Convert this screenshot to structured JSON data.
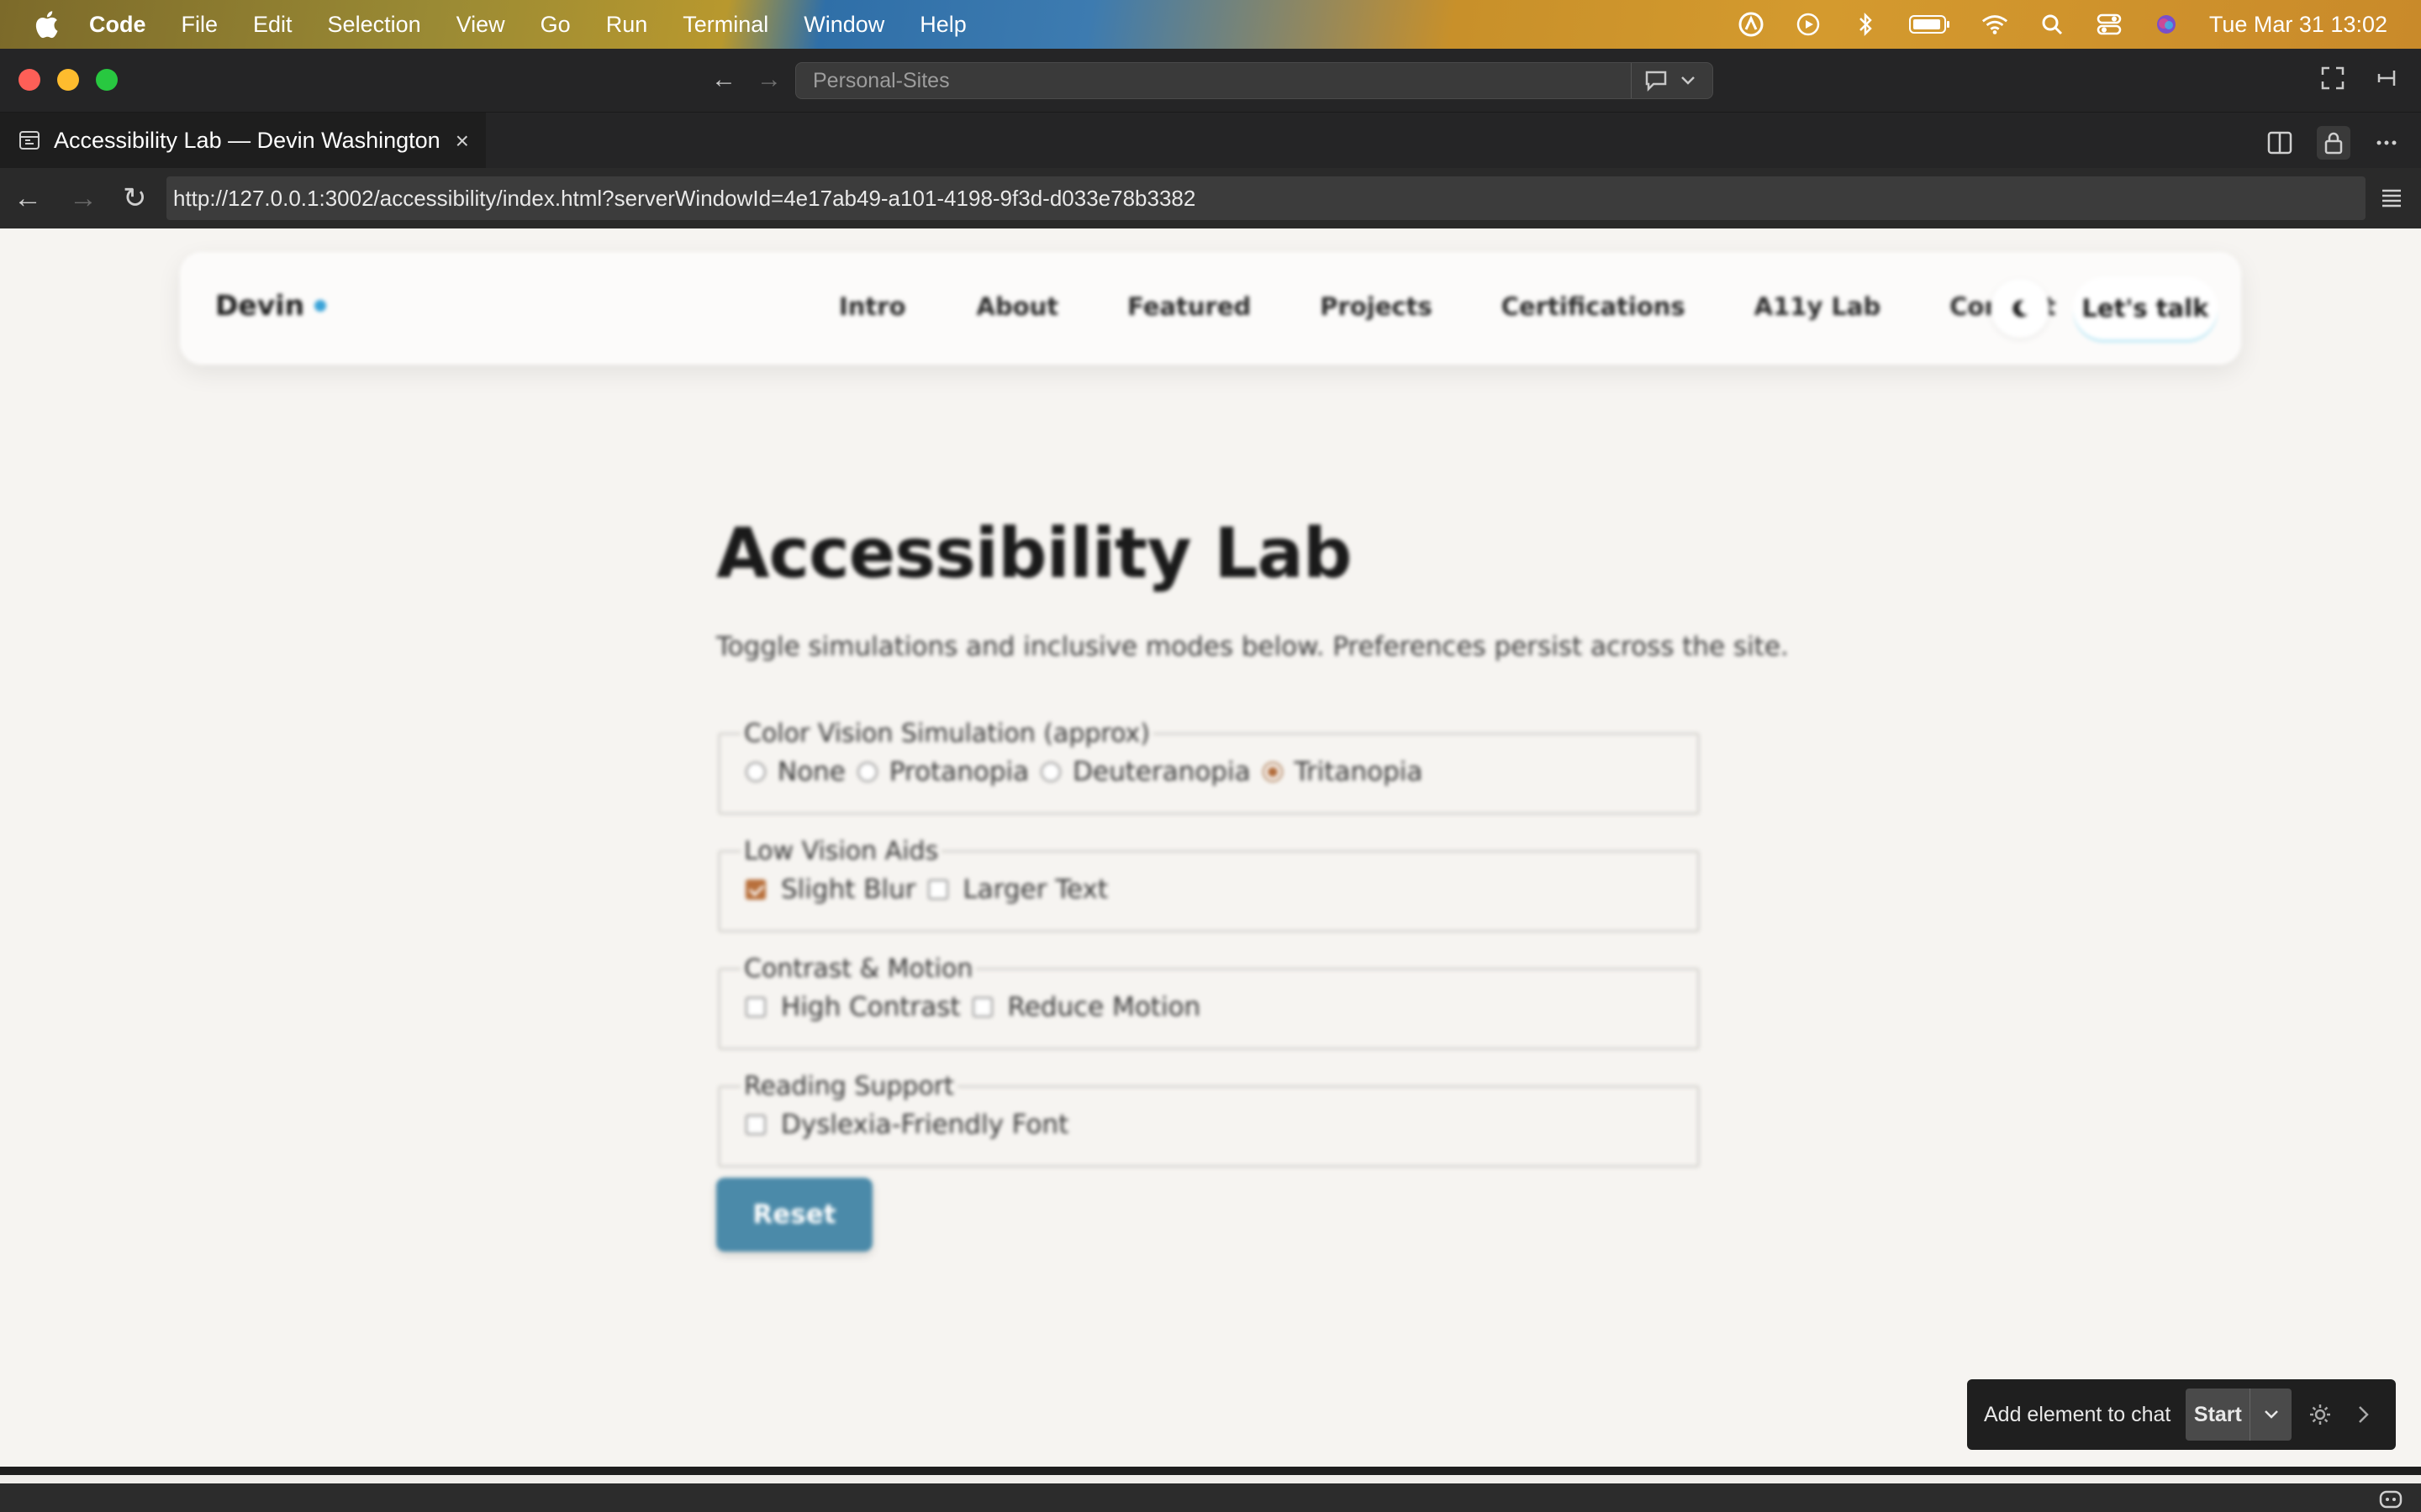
{
  "menubar": {
    "app_name": "Code",
    "items": [
      "File",
      "Edit",
      "Selection",
      "View",
      "Go",
      "Run",
      "Terminal",
      "Window",
      "Help"
    ],
    "clock": "Tue Mar 31  13:02"
  },
  "titlebar": {
    "command_center": "Personal-Sites"
  },
  "tab": {
    "title": "Accessibility Lab — Devin Washington",
    "close": "×"
  },
  "address": {
    "url": "http://127.0.0.1:3002/accessibility/index.html?serverWindowId=4e17ab49-a101-4198-9f3d-d033e78b3382"
  },
  "site": {
    "brand": "Devin",
    "nav": [
      "Intro",
      "About",
      "Featured",
      "Projects",
      "Certifications",
      "A11y Lab",
      "Contact"
    ],
    "cta": "Let's talk"
  },
  "page": {
    "title": "Accessibility Lab",
    "description": "Toggle simulations and inclusive modes below. Preferences persist across the site.",
    "groups": [
      {
        "legend": "Color Vision Simulation (approx)",
        "type": "radio",
        "options": [
          {
            "label": "None",
            "checked": false
          },
          {
            "label": "Protanopia",
            "checked": false
          },
          {
            "label": "Deuteranopia",
            "checked": false
          },
          {
            "label": "Tritanopia",
            "checked": true
          }
        ]
      },
      {
        "legend": "Low Vision Aids",
        "type": "checkbox",
        "options": [
          {
            "label": "Slight Blur",
            "checked": true
          },
          {
            "label": "Larger Text",
            "checked": false
          }
        ]
      },
      {
        "legend": "Contrast & Motion",
        "type": "checkbox",
        "options": [
          {
            "label": "High Contrast",
            "checked": false
          },
          {
            "label": "Reduce Motion",
            "checked": false
          }
        ]
      },
      {
        "legend": "Reading Support",
        "type": "checkbox",
        "options": [
          {
            "label": "Dyslexia-Friendly Font",
            "checked": false
          }
        ]
      }
    ],
    "reset_label": "Reset"
  },
  "chat_overlay": {
    "label": "Add element to chat",
    "start_label": "Start"
  },
  "colors": {
    "accent_checked": "#b8703c",
    "reset_button": "#4b8aa9",
    "brand_dot": "#3aa3d8"
  }
}
